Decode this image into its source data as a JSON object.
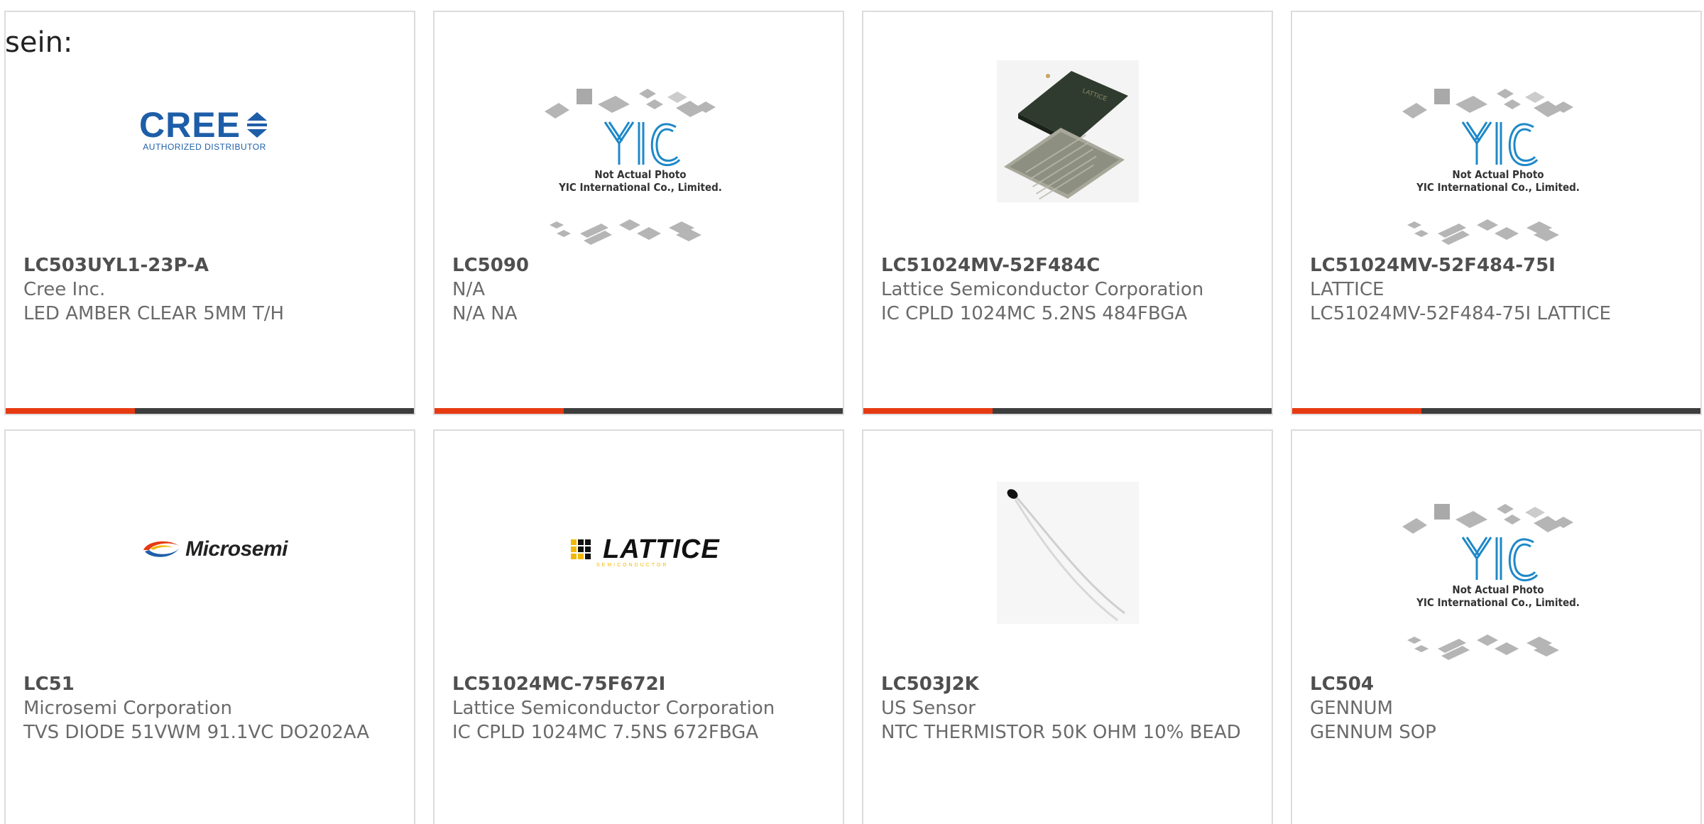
{
  "intro": "sein:",
  "products": [
    {
      "part": "LC503UYL1-23P-A",
      "manufacturer": "Cree Inc.",
      "description": "LED AMBER CLEAR 5MM T/H",
      "image": "cree-logo"
    },
    {
      "part": "LC5090",
      "manufacturer": "N/A",
      "description": "N/A NA",
      "image": "not-actual-photo"
    },
    {
      "part": "LC51024MV-52F484C",
      "manufacturer": "Lattice Semiconductor Corporation",
      "description": "IC CPLD 1024MC 5.2NS 484FBGA",
      "image": "bga-chip-photo"
    },
    {
      "part": "LC51024MV-52F484-75I",
      "manufacturer": "LATTICE",
      "description": "LC51024MV-52F484-75I LATTICE",
      "image": "not-actual-photo"
    },
    {
      "part": "LC51",
      "manufacturer": "Microsemi Corporation",
      "description": "TVS DIODE 51VWM 91.1VC DO202AA",
      "image": "microsemi-logo"
    },
    {
      "part": "LC51024MC-75F672I",
      "manufacturer": "Lattice Semiconductor Corporation",
      "description": "IC CPLD 1024MC 7.5NS 672FBGA",
      "image": "lattice-logo"
    },
    {
      "part": "LC503J2K",
      "manufacturer": "US Sensor",
      "description": "NTC THERMISTOR 50K OHM 10% BEAD",
      "image": "thermistor-photo"
    },
    {
      "part": "LC504",
      "manufacturer": "GENNUM",
      "description": "GENNUM SOP",
      "image": "not-actual-photo"
    }
  ],
  "logos": {
    "cree_word": "CREE",
    "cree_sub": "AUTHORIZED DISTRIBUTOR",
    "yic_line1": "Not Actual Photo",
    "yic_line2": "YIC International Co., Limited.",
    "microsemi": "Microsemi",
    "lattice": "LATTICE",
    "lattice_sub": "SEMICONDUCTOR"
  },
  "colors": {
    "accent": "#e63a12",
    "bar": "#3d3d3d",
    "part_text": "#4f4f4f",
    "body_text": "#6a6a6a",
    "cree_blue": "#1e5ea8"
  }
}
